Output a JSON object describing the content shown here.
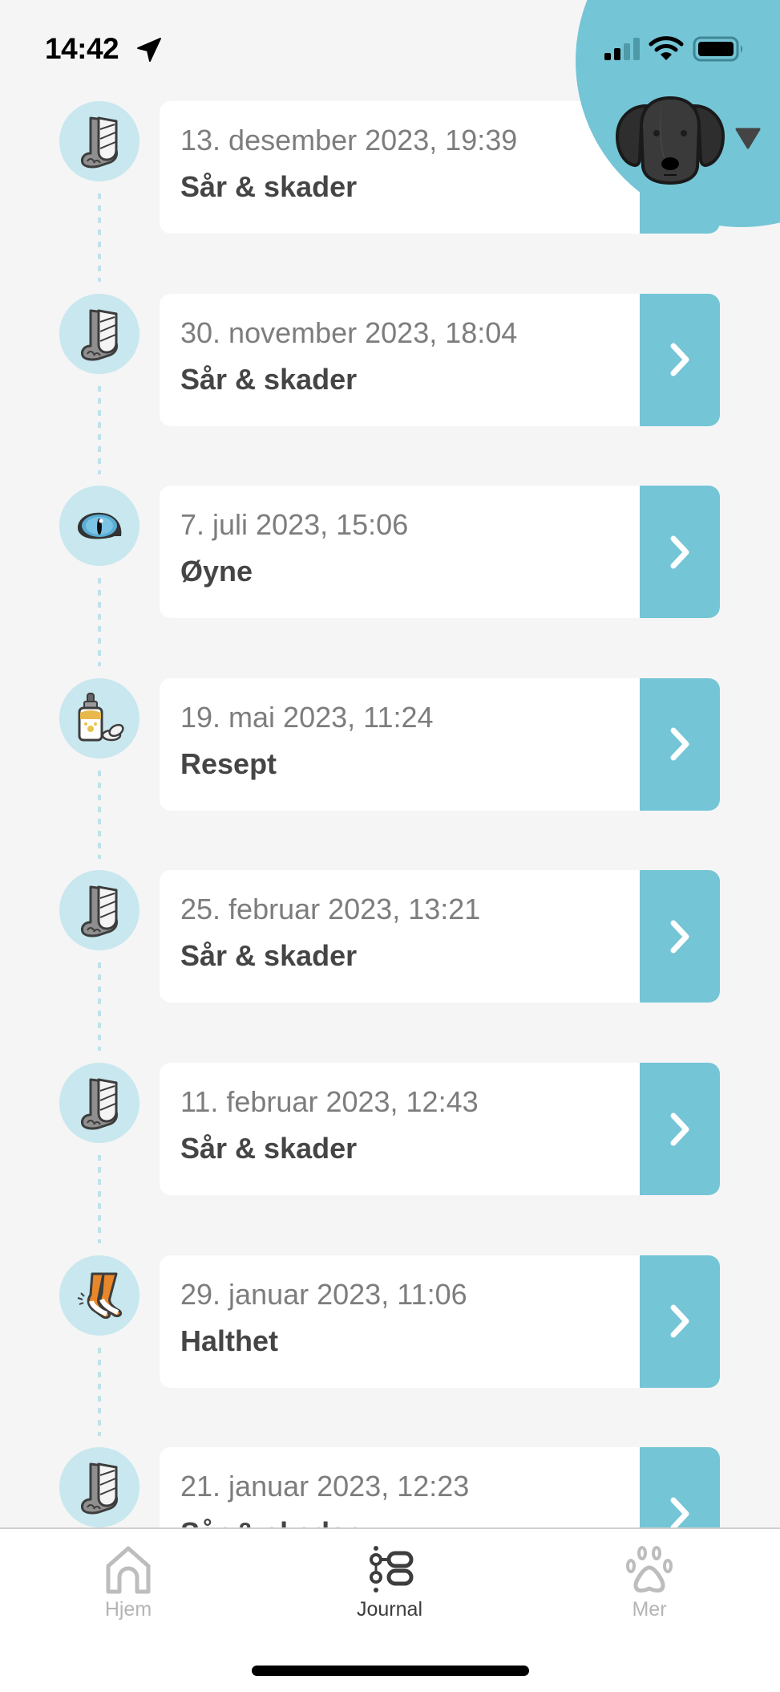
{
  "status_bar": {
    "time": "14:42",
    "icons": [
      "location-arrow-icon",
      "cellular-signal-icon",
      "wifi-icon",
      "battery-icon"
    ],
    "signal_bars_filled": 2,
    "signal_bars_total": 4
  },
  "profile": {
    "avatar_icon": "black-dog-head-icon",
    "dropdown_icon": "caret-down-icon"
  },
  "colors": {
    "accent": "#74c5d6",
    "icon_circle": "#c8e7ee",
    "background": "#f5f5f5",
    "date_text": "#7d7d7d",
    "title_text": "#454545"
  },
  "journal": {
    "entries": [
      {
        "date": "13. desember 2023, 19:39",
        "category": "Sår & skader",
        "icon": "bandaged-paw-icon"
      },
      {
        "date": "30. november 2023, 18:04",
        "category": "Sår & skader",
        "icon": "bandaged-paw-icon"
      },
      {
        "date": "7. juli 2023, 15:06",
        "category": "Øyne",
        "icon": "eye-icon"
      },
      {
        "date": "19. mai 2023, 11:24",
        "category": "Resept",
        "icon": "medicine-bottle-icon"
      },
      {
        "date": "25. februar 2023, 13:21",
        "category": "Sår & skader",
        "icon": "bandaged-paw-icon"
      },
      {
        "date": "11. februar 2023, 12:43",
        "category": "Sår & skader",
        "icon": "bandaged-paw-icon"
      },
      {
        "date": "29. januar 2023, 11:06",
        "category": "Halthet",
        "icon": "limping-legs-icon"
      },
      {
        "date": "21. januar 2023, 12:23",
        "category": "Sår & skader",
        "icon": "bandaged-paw-icon"
      }
    ],
    "open_icon": "chevron-right-icon"
  },
  "tabbar": {
    "tabs": [
      {
        "label": "Hjem",
        "icon": "home-icon",
        "active": false
      },
      {
        "label": "Journal",
        "icon": "journal-timeline-icon",
        "active": true
      },
      {
        "label": "Mer",
        "icon": "paw-icon",
        "active": false
      }
    ]
  }
}
